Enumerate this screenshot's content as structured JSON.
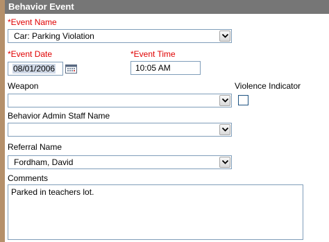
{
  "header": {
    "title": "Behavior Event"
  },
  "fields": {
    "event_name": {
      "label": "*Event Name",
      "value": "Car: Parking Violation"
    },
    "event_date": {
      "label": "*Event Date",
      "value": "08/01/2006"
    },
    "event_time": {
      "label": "*Event Time",
      "value": "10:05 AM"
    },
    "weapon": {
      "label": "Weapon",
      "value": ""
    },
    "violence_indicator": {
      "label": "Violence Indicator",
      "checked": false
    },
    "admin_staff": {
      "label": "Behavior Admin Staff Name",
      "value": ""
    },
    "referral": {
      "label": "Referral Name",
      "value": "Fordham, David"
    },
    "comments": {
      "label": "Comments",
      "value": "Parked in teachers lot."
    }
  },
  "colors": {
    "required": "#e00000",
    "header_bg": "#767676",
    "accent_border": "#b5906a"
  },
  "icons": {
    "dropdown": "chevron-down-icon",
    "calendar": "calendar-icon"
  }
}
